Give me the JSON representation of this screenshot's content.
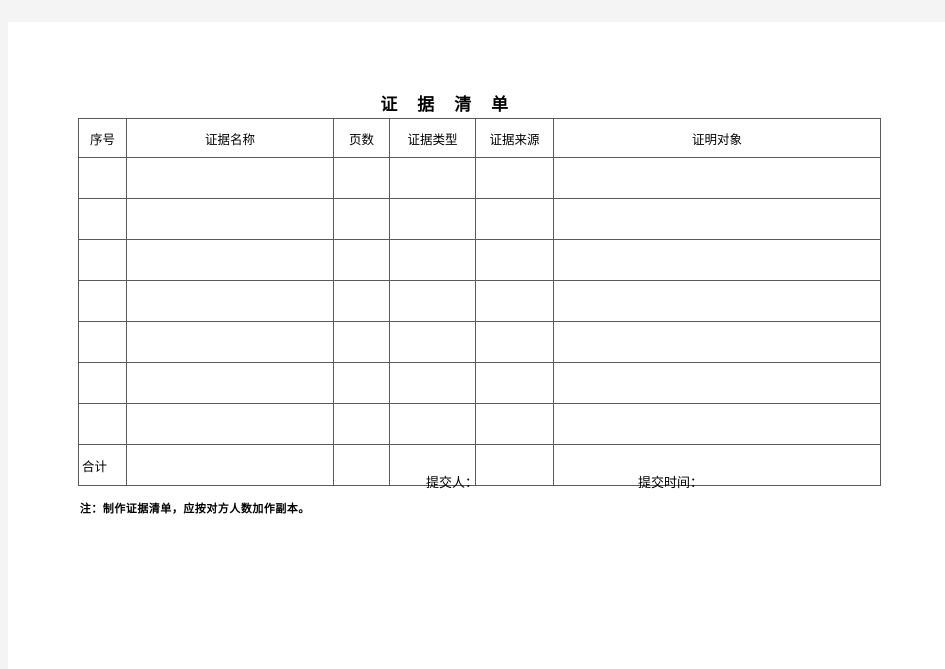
{
  "document": {
    "title": "证 据 清 单",
    "background_color": "#f4f4f4",
    "page_color": "#ffffff",
    "border_color": "#5a5a5a"
  },
  "table": {
    "headers": [
      "序号",
      "证据名称",
      "页数",
      "证据类型",
      "证据来源",
      "证明对象"
    ],
    "empty_row_count": 7,
    "rows": [
      [
        "",
        "",
        "",
        "",
        "",
        ""
      ],
      [
        "",
        "",
        "",
        "",
        "",
        ""
      ],
      [
        "",
        "",
        "",
        "",
        "",
        ""
      ],
      [
        "",
        "",
        "",
        "",
        "",
        ""
      ],
      [
        "",
        "",
        "",
        "",
        "",
        ""
      ],
      [
        "",
        "",
        "",
        "",
        "",
        ""
      ],
      [
        "",
        "",
        "",
        "",
        "",
        ""
      ]
    ],
    "total_row": {
      "label": "合计",
      "name": "",
      "pages": "",
      "type": "",
      "source": "",
      "proof": ""
    }
  },
  "signature": {
    "submitter_label": "提交人：",
    "time_label": "提交时间："
  },
  "footer": {
    "note": "注：制作证据清单，应按对方人数加作副本。"
  }
}
